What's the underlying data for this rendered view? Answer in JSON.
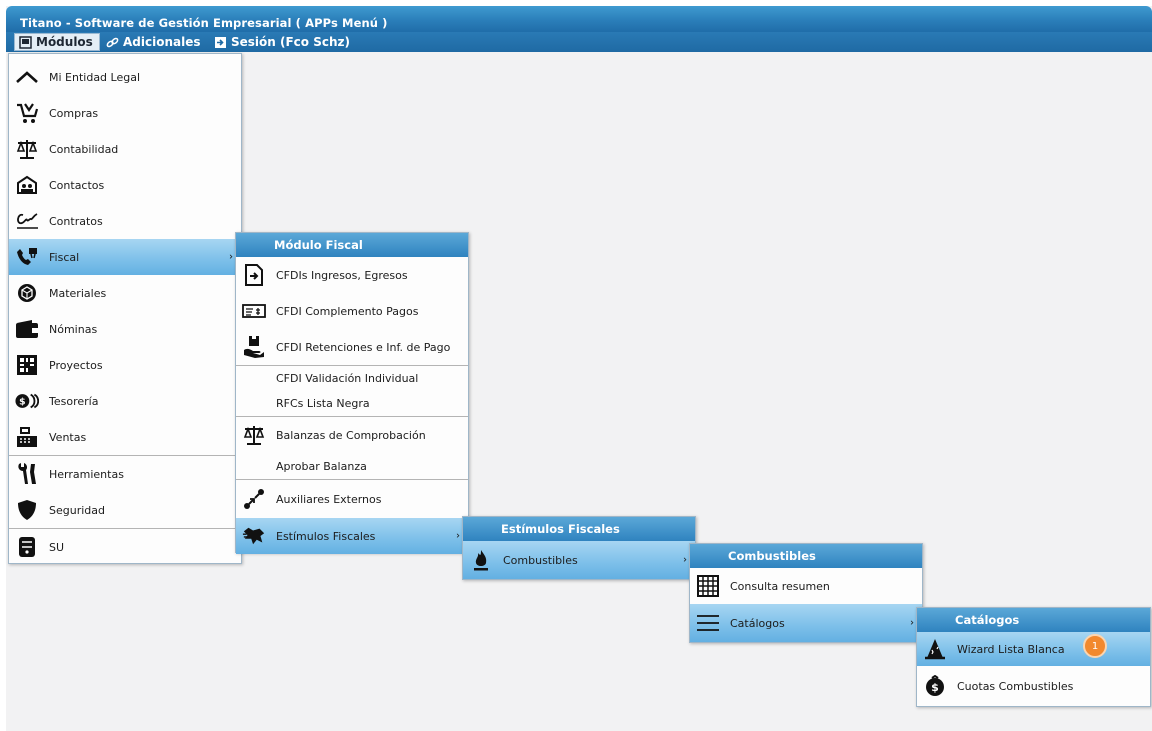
{
  "window": {
    "title": "Titano - Software de Gestión Empresarial ( APPs Menú )"
  },
  "menubar": {
    "items": [
      {
        "label": "Módulos",
        "icon": "monitor-icon",
        "active": true
      },
      {
        "label": "Adicionales",
        "icon": "link-icon"
      },
      {
        "label": "Sesión (Fco Schz)",
        "icon": "logout-icon"
      }
    ]
  },
  "modulos_menu": {
    "items": [
      {
        "label": "Mi Entidad Legal",
        "icon": "chart-peak-icon"
      },
      {
        "label": "Compras",
        "icon": "cart-icon"
      },
      {
        "label": "Contabilidad",
        "icon": "scales-icon"
      },
      {
        "label": "Contactos",
        "icon": "contacts-icon"
      },
      {
        "label": "Contratos",
        "icon": "signature-icon"
      },
      {
        "label": "Fiscal",
        "icon": "fiscal-icon",
        "selected": true
      },
      {
        "label": "Materiales",
        "icon": "box-icon"
      },
      {
        "label": "Nóminas",
        "icon": "wallet-icon"
      },
      {
        "label": "Proyectos",
        "icon": "grid-icon"
      },
      {
        "label": "Tesorería",
        "icon": "coins-icon"
      },
      {
        "label": "Ventas",
        "icon": "register-icon"
      },
      {
        "label": "Herramientas",
        "icon": "tools-icon"
      },
      {
        "label": "Seguridad",
        "icon": "shield-icon"
      },
      {
        "label": "SU",
        "icon": "server-icon"
      }
    ]
  },
  "fiscal_menu": {
    "title": "Módulo Fiscal",
    "items": [
      {
        "label": "CFDIs Ingresos, Egresos",
        "icon": "document-arrow-icon"
      },
      {
        "label": "CFDI Complemento Pagos",
        "icon": "check-payment-icon"
      },
      {
        "label": "CFDI Retenciones e Inf. de Pago",
        "icon": "hand-box-icon"
      },
      {
        "label": "CFDI Validación Individual"
      },
      {
        "label": "RFCs Lista Negra"
      },
      {
        "label": "Balanzas de Comprobación",
        "icon": "scales-icon"
      },
      {
        "label": "Aprobar Balanza"
      },
      {
        "label": "Auxiliares Externos",
        "icon": "external-link-icon"
      },
      {
        "label": "Estímulos Fiscales",
        "icon": "stimulus-icon",
        "selected": true
      }
    ]
  },
  "estimulos_menu": {
    "title": "Estímulos Fiscales",
    "items": [
      {
        "label": "Combustibles",
        "icon": "flame-icon",
        "selected": true
      }
    ]
  },
  "combustibles_menu": {
    "title": "Combustibles",
    "items": [
      {
        "label": "Consulta resumen",
        "icon": "table-grid-icon"
      },
      {
        "label": "Catálogos",
        "icon": "list-icon",
        "selected": true
      }
    ]
  },
  "catalogos_menu": {
    "title": "Catálogos",
    "items": [
      {
        "label": "Wizard Lista Blanca",
        "icon": "wizard-hat-icon",
        "selected": true,
        "badge": "1"
      },
      {
        "label": "Cuotas Combustibles",
        "icon": "money-bag-icon"
      }
    ]
  }
}
